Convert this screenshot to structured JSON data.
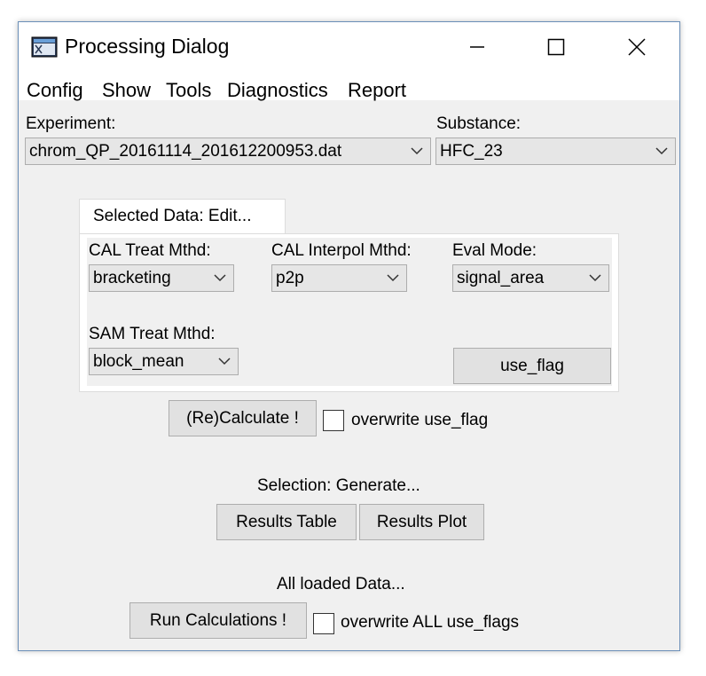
{
  "window": {
    "title": "Processing Dialog",
    "icon": "app-window-icon",
    "controls": [
      "minimize-icon",
      "maximize-icon",
      "close-icon"
    ]
  },
  "menu": {
    "items": [
      "Config",
      "Show",
      "Tools",
      "Diagnostics",
      "Report"
    ]
  },
  "experiment": {
    "label": "Experiment:",
    "value": "chrom_QP_20161114_201612200953.dat"
  },
  "substance": {
    "label": "Substance:",
    "value": "HFC_23"
  },
  "selected_data": {
    "tab_label": "Selected Data: Edit...",
    "cal_treat": {
      "label": "CAL Treat Mthd:",
      "value": "bracketing"
    },
    "cal_interpol": {
      "label": "CAL Interpol Mthd:",
      "value": "p2p"
    },
    "eval_mode": {
      "label": "Eval Mode:",
      "value": "signal_area"
    },
    "sam_treat": {
      "label": "SAM Treat Mthd:",
      "value": "block_mean"
    },
    "use_flag_button": "use_flag"
  },
  "recalc": {
    "button": "(Re)Calculate !",
    "overwrite_label": "overwrite use_flag",
    "overwrite_checked": false
  },
  "selection": {
    "label": "Selection: Generate...",
    "results_table": "Results Table",
    "results_plot": "Results Plot"
  },
  "all_data": {
    "label": "All loaded Data...",
    "run_button": "Run Calculations !",
    "overwrite_label": "overwrite ALL use_flags",
    "overwrite_checked": false
  },
  "colors": {
    "window_border": "#6b8fb8",
    "dialog_bg": "#f0f0f0",
    "button_bg": "#e1e1e1",
    "combo_bg": "#e6e6e6"
  }
}
